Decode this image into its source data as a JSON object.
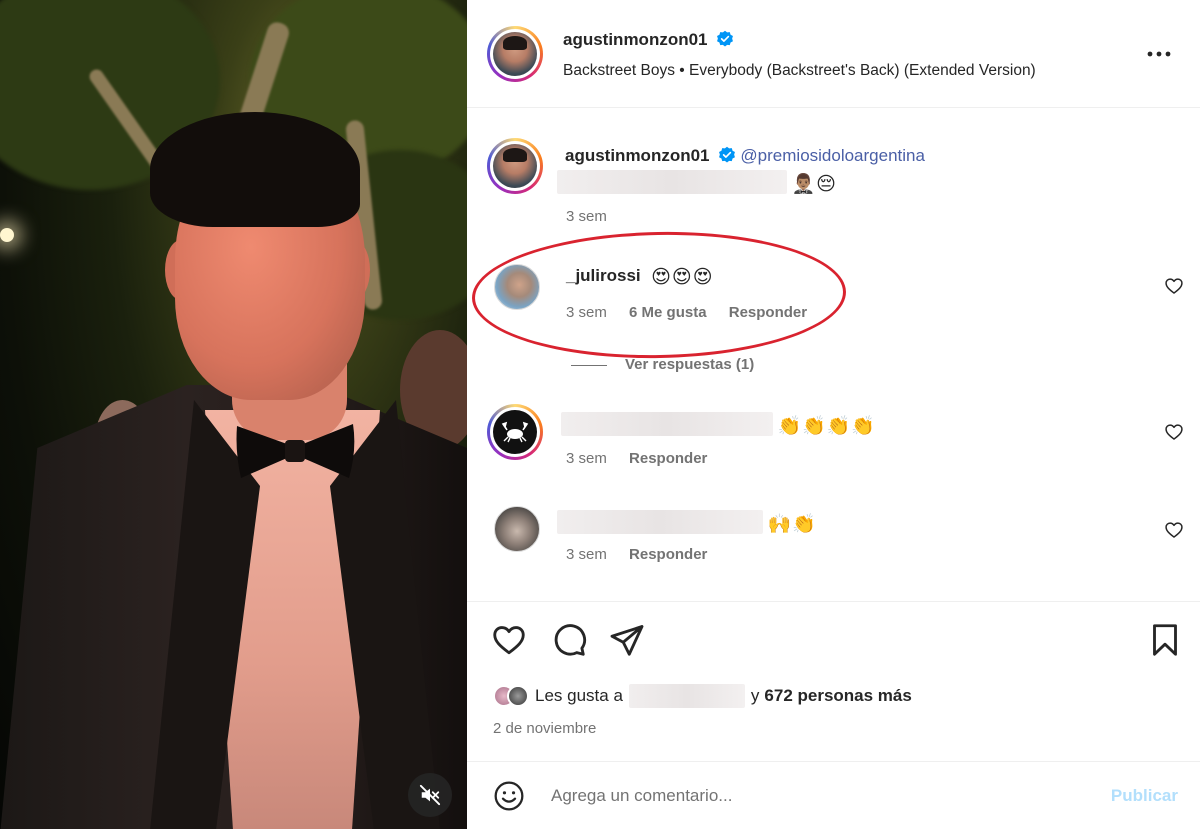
{
  "post": {
    "author": "agustinmonzon01",
    "audio": "Backstreet Boys • Everybody (Backstreet's Back) (Extended Version)"
  },
  "caption": {
    "author": "agustinmonzon01",
    "mention": "@premiosidoloargentina",
    "emojis": "🤵🏽‍♂️😔",
    "time": "3 sem"
  },
  "comments": [
    {
      "username": "_julirossi",
      "text": "😍😍😍",
      "time": "3 sem",
      "likes": "6 Me gusta",
      "reply": "Responder",
      "view_replies": "Ver respuestas (1)"
    },
    {
      "username": "",
      "text": "👏👏👏👏",
      "time": "3 sem",
      "reply": "Responder"
    },
    {
      "username": "",
      "text": "🙌👏",
      "time": "3 sem",
      "reply": "Responder"
    }
  ],
  "likes": {
    "prefix": "Les gusta a",
    "suffix": "y",
    "count_text": "672 personas más"
  },
  "date": "2 de noviembre",
  "composer": {
    "placeholder": "Agrega un comentario...",
    "publish": "Publicar"
  },
  "colors": {
    "verified": "#0095f6",
    "annotation_circle": "#d9232f",
    "publish_disabled": "#b2dffc"
  }
}
